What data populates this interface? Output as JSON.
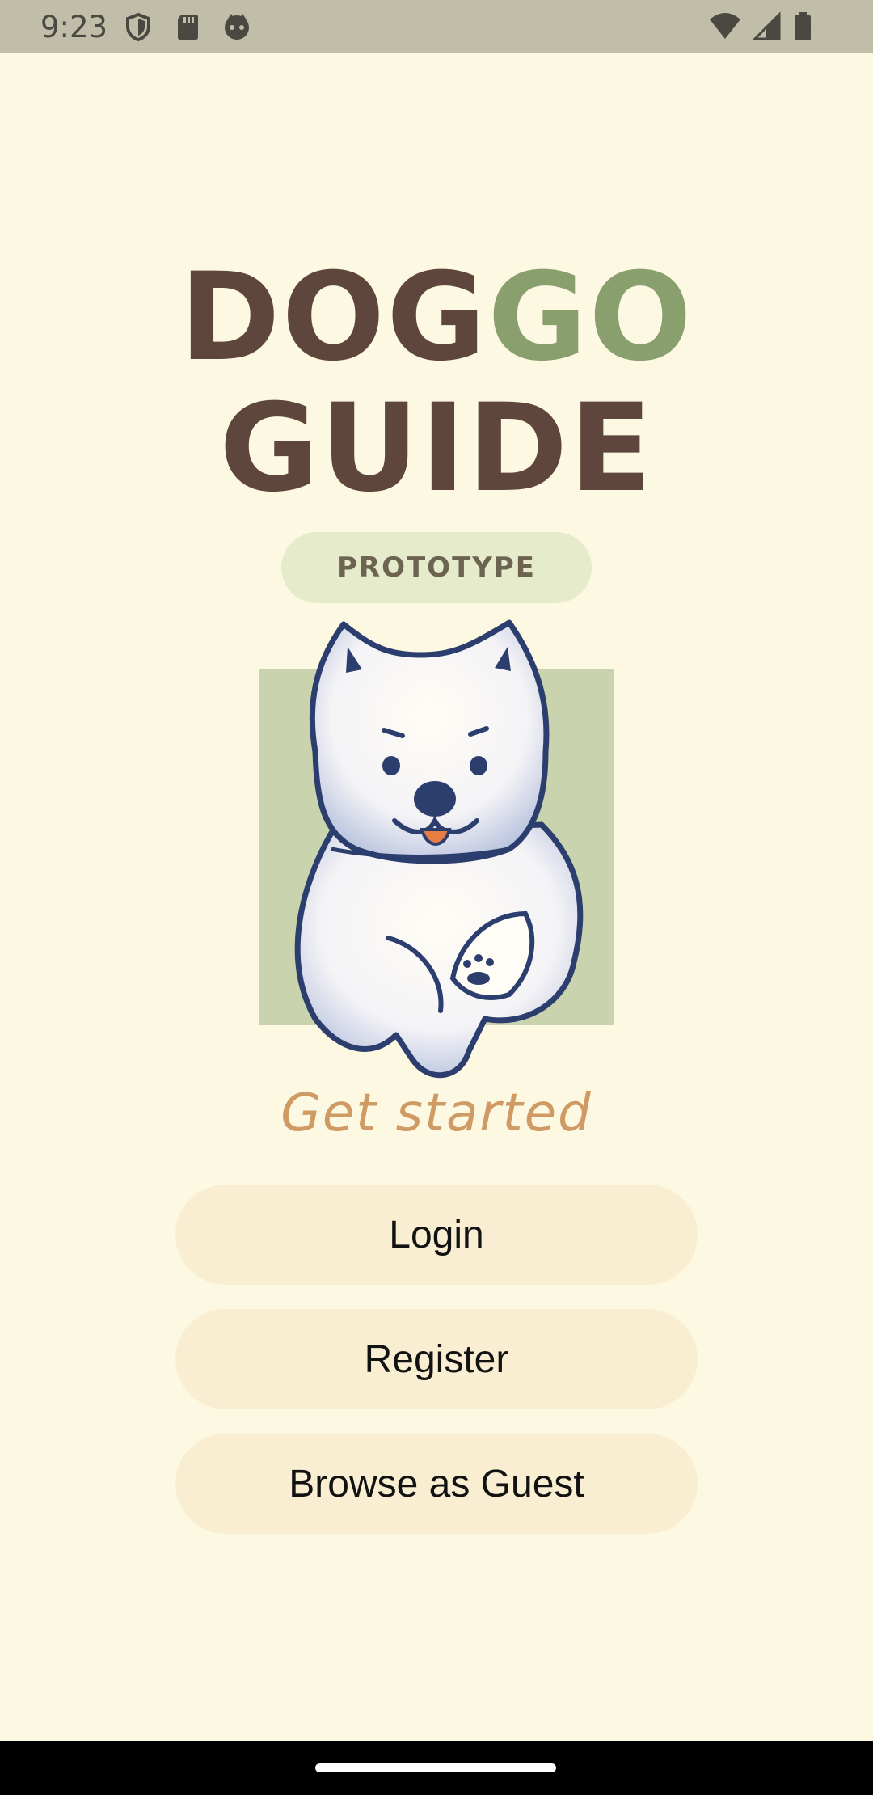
{
  "status_bar": {
    "time": "9:23",
    "left_icons": [
      "shield-icon",
      "sd-card-icon",
      "face-icon"
    ],
    "right_icons": [
      "wifi-icon",
      "signal-icon",
      "battery-icon"
    ],
    "bg_color": "#c0bda9"
  },
  "app": {
    "title_part1": "DOG",
    "title_part2": "GO",
    "title_line2": "GUIDE",
    "badge": "PROTOTYPE",
    "get_started": "Get started",
    "colors": {
      "background": "#fdf8e1",
      "title_brown": "#5e463d",
      "title_green": "#8a9f6e",
      "badge_bg": "#e6ebcc",
      "button_bg": "#f9eed1",
      "get_started": "#cf9a63"
    }
  },
  "buttons": {
    "login": "Login",
    "register": "Register",
    "guest": "Browse as Guest"
  }
}
